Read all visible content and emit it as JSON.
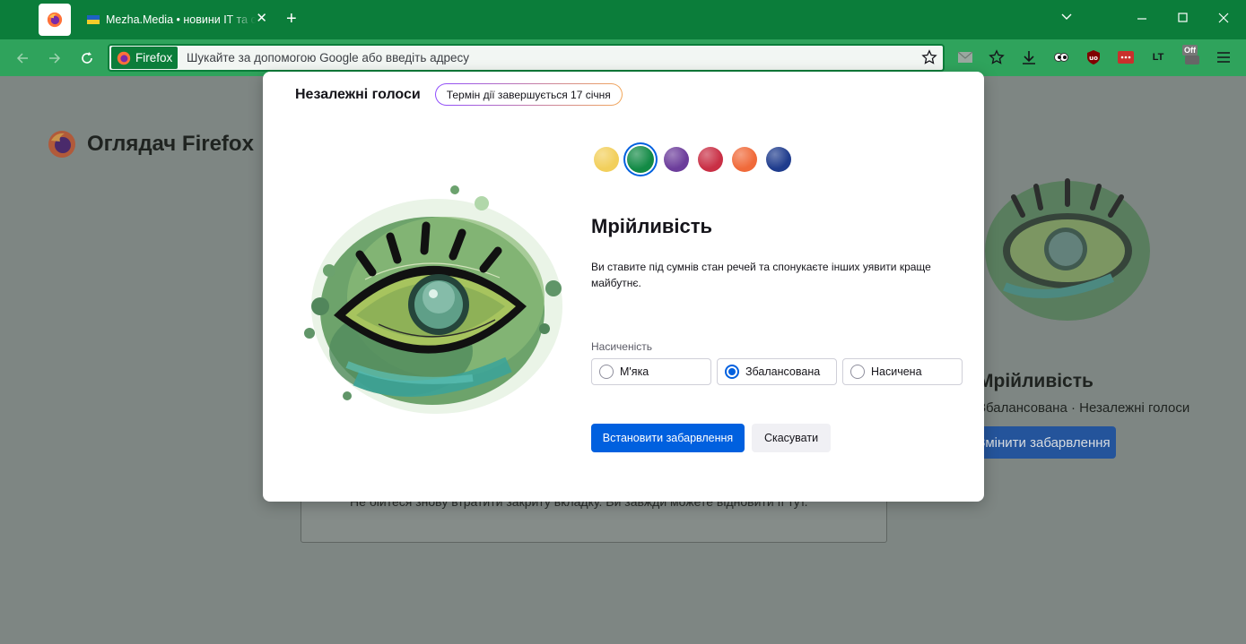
{
  "browser": {
    "tab": {
      "title": "Mezha.Media • новини IT та огляди",
      "close_glyph": "✕"
    },
    "new_tab_glyph": "+",
    "window_controls": {
      "list": "⌄",
      "minimize": "—",
      "maximize": "☐",
      "close": "✕"
    },
    "urlbar": {
      "identity_label": "Firefox",
      "placeholder": "Шукайте за допомогою Google або введіть адресу"
    },
    "accent_color": "#0b7d3a",
    "toolbar_color": "#2fa35c",
    "extensions": {
      "lt_label": "LT",
      "off_badge": "Off"
    }
  },
  "page": {
    "brand": "Оглядач Firefox",
    "card_text": "Не бійтеся знову втратити закриту вкладку. Ви завжди можете відновити її тут.",
    "variant_title_partial": "Мрійливість",
    "variant_subtitle_partial": "Збалансована · Незалежні голоси",
    "change_button_partial": "Змінити забарвлення"
  },
  "modal": {
    "title": "Незалежні голоси",
    "expiry": "Термін дії завершується 17 січня",
    "swatches": [
      {
        "name": "yellow",
        "color": "#f2cf5b",
        "selected": false
      },
      {
        "name": "green",
        "color": "#128a45",
        "selected": true
      },
      {
        "name": "purple",
        "color": "#6c3d9b",
        "selected": false
      },
      {
        "name": "red",
        "color": "#c92f45",
        "selected": false
      },
      {
        "name": "orange",
        "color": "#f06a3a",
        "selected": false
      },
      {
        "name": "blue",
        "color": "#1f3c8d",
        "selected": false
      }
    ],
    "variant_name": "Мрійливість",
    "description": "Ви ставите під сумнів стан речей та спонукаєте інших уявити краще майбутнє.",
    "intensity_label": "Насиченість",
    "intensity_options": [
      {
        "label": "М'яка",
        "selected": false
      },
      {
        "label": "Збалансована",
        "selected": true
      },
      {
        "label": "Насичена",
        "selected": false
      }
    ],
    "primary_button": "Встановити забарвлення",
    "secondary_button": "Скасувати"
  }
}
